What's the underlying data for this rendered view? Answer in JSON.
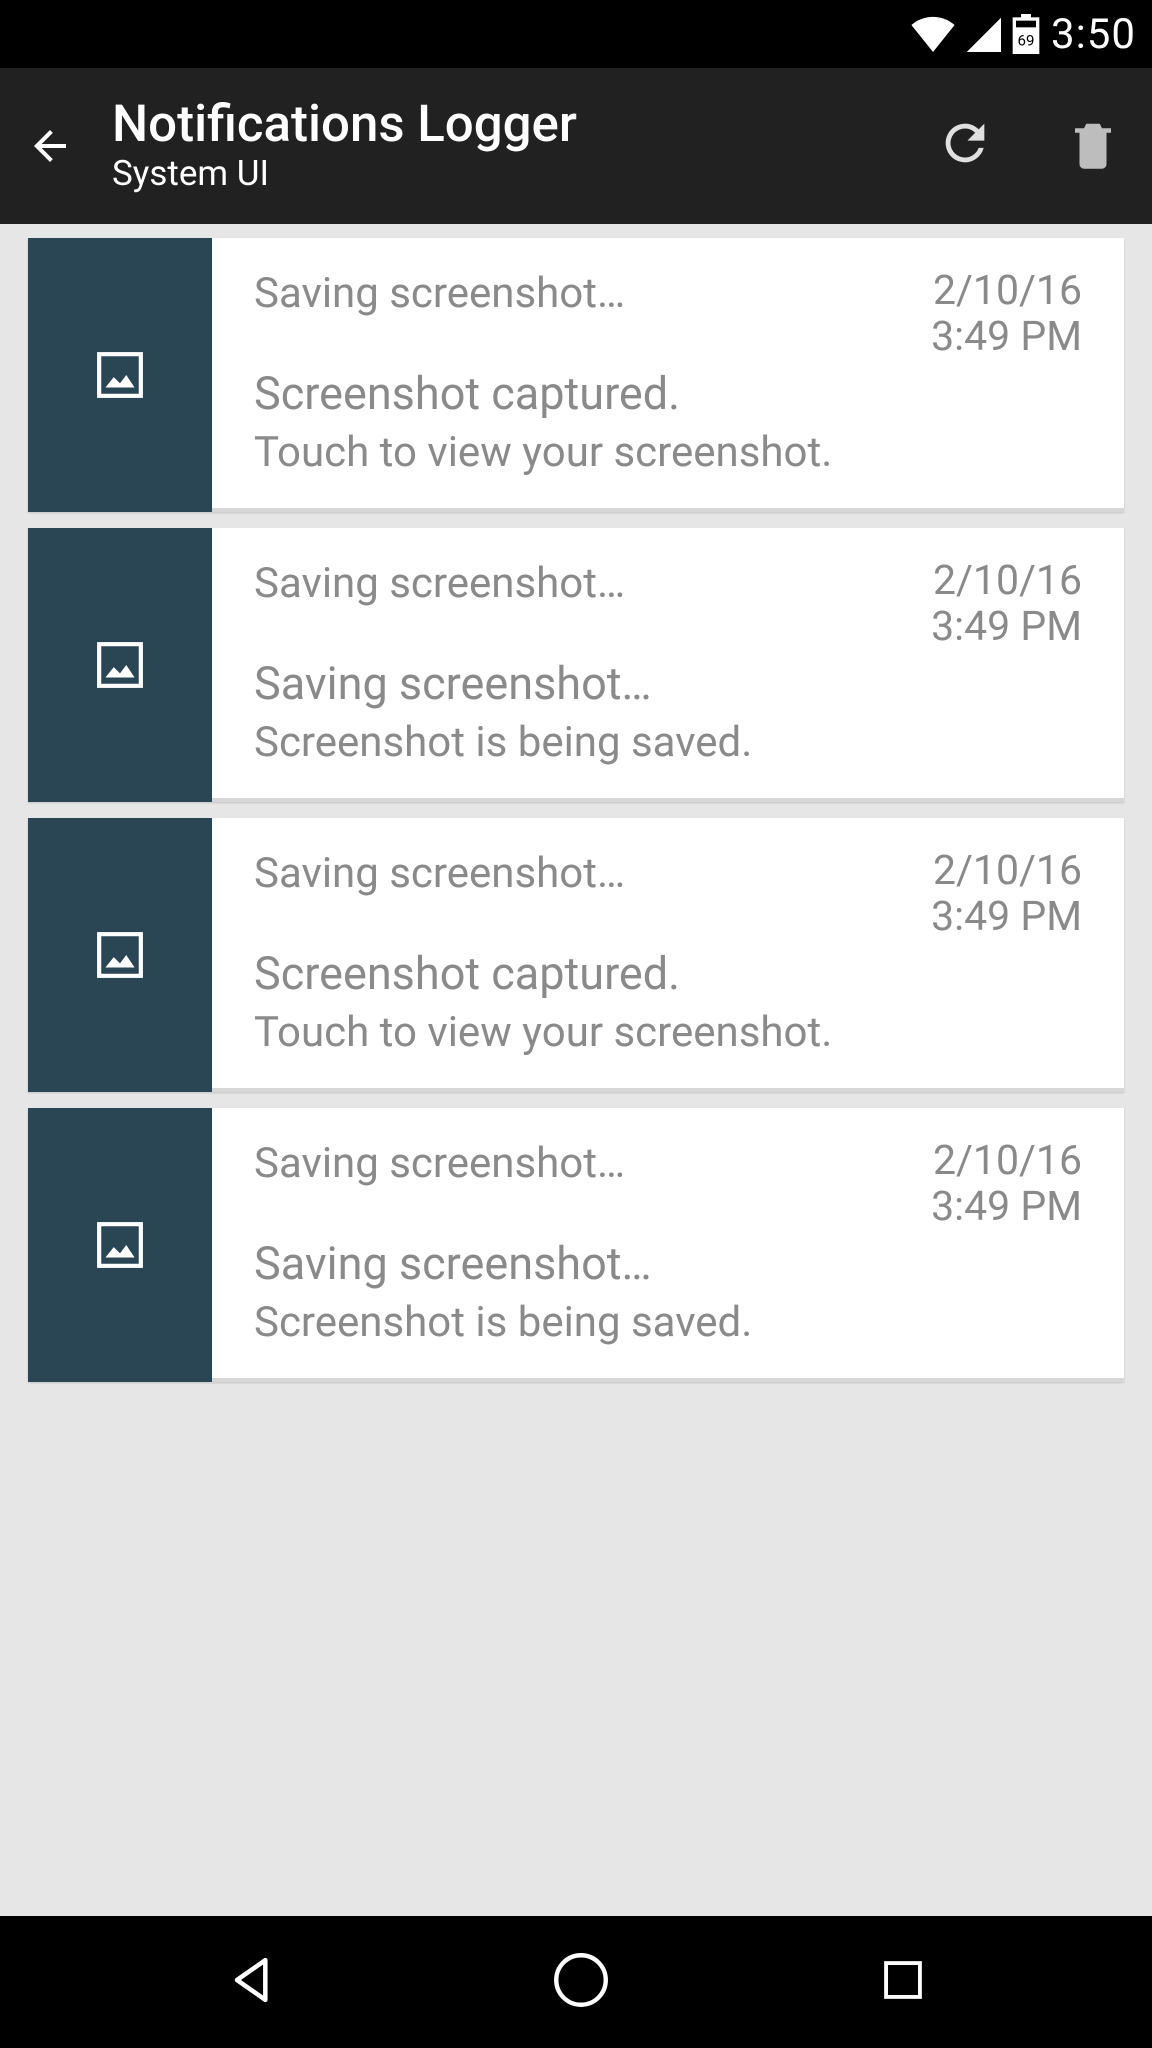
{
  "status": {
    "battery_label": "69",
    "time": "3:50"
  },
  "actionbar": {
    "title": "Notifications Logger",
    "subtitle": "System UI"
  },
  "items": [
    {
      "title": "Saving screenshot…",
      "headline": "Screenshot captured.",
      "sub": "Touch to view your screenshot.",
      "date": "2/10/16",
      "time": "3:49 PM"
    },
    {
      "title": "Saving screenshot…",
      "headline": "Saving screenshot…",
      "sub": "Screenshot is being saved.",
      "date": "2/10/16",
      "time": "3:49 PM"
    },
    {
      "title": "Saving screenshot…",
      "headline": "Screenshot captured.",
      "sub": "Touch to view your screenshot.",
      "date": "2/10/16",
      "time": "3:49 PM"
    },
    {
      "title": "Saving screenshot…",
      "headline": "Saving screenshot…",
      "sub": "Screenshot is being saved.",
      "date": "2/10/16",
      "time": "3:49 PM"
    }
  ]
}
